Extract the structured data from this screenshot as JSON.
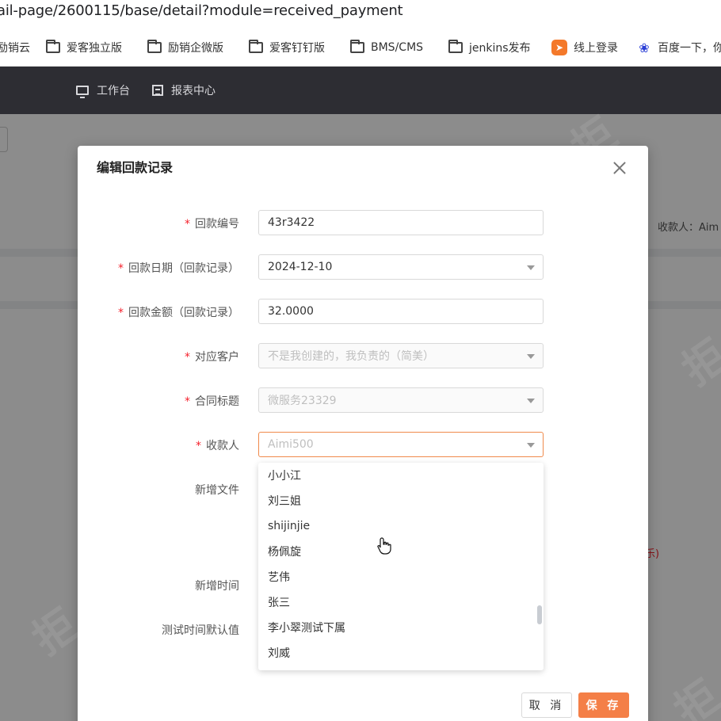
{
  "browser": {
    "url": "ail-page/2600115/base/detail?module=received_payment",
    "bookmarks": [
      {
        "label": "励销云",
        "icon": "folder-icon"
      },
      {
        "label": "爱客独立版",
        "icon": "folder-icon"
      },
      {
        "label": "励销企微版",
        "icon": "folder-icon"
      },
      {
        "label": "爱客钉钉版",
        "icon": "folder-icon"
      },
      {
        "label": "BMS/CMS",
        "icon": "folder-icon"
      },
      {
        "label": "jenkins发布",
        "icon": "folder-icon"
      },
      {
        "label": "线上登录",
        "icon": "login-app-icon"
      },
      {
        "label": "百度一下，你",
        "icon": "baidu-paw-icon"
      }
    ]
  },
  "topnav": {
    "workbench": "工作台",
    "reports": "报表中心"
  },
  "background": {
    "receiver_label": "收款人：Aim",
    "red_text": "乐)"
  },
  "modal": {
    "title": "编辑回款记录",
    "fields": {
      "payment_no": {
        "label": "回款编号",
        "value": "43r3422"
      },
      "payment_date": {
        "label": "回款日期（回款记录）",
        "value": "2024-12-10"
      },
      "payment_amount": {
        "label": "回款金额（回款记录）",
        "value": "32.0000"
      },
      "customer": {
        "label": "对应客户",
        "placeholder": "不是我创建的，我负责的（简美）"
      },
      "contract_title": {
        "label": "合同标题",
        "placeholder": "微服务23329"
      },
      "receiver": {
        "label": "收款人",
        "placeholder": "Aimi500"
      },
      "new_file": {
        "label": "新增文件"
      },
      "new_time": {
        "label": "新增时间"
      },
      "test_time_default": {
        "label": "测试时间默认值"
      }
    },
    "receiver_options": [
      "小小江",
      "刘三姐",
      "shijinjie",
      "杨佩旋",
      "艺伟",
      "张三",
      "李小翠测试下属",
      "刘威"
    ],
    "buttons": {
      "cancel": "取 消",
      "save": "保 存"
    }
  },
  "colors": {
    "accent": "#f47f47",
    "required": "#f5222d",
    "nav_bg": "#2d2d33"
  }
}
